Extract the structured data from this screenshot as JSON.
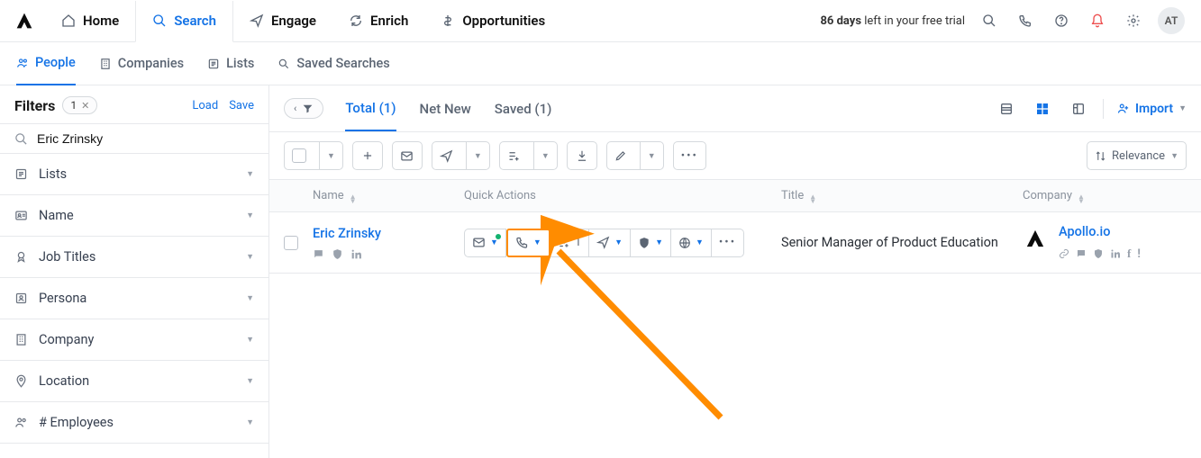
{
  "nav": {
    "items": [
      {
        "label": "Home"
      },
      {
        "label": "Search"
      },
      {
        "label": "Engage"
      },
      {
        "label": "Enrich"
      },
      {
        "label": "Opportunities"
      }
    ],
    "trial_days": "86 days",
    "trial_rest": " left in your free trial",
    "avatar": "AT"
  },
  "subnav": {
    "items": [
      {
        "label": "People"
      },
      {
        "label": "Companies"
      },
      {
        "label": "Lists"
      },
      {
        "label": "Saved Searches"
      }
    ]
  },
  "filters": {
    "title": "Filters",
    "chip_count": "1",
    "load": "Load",
    "save": "Save",
    "search_value": "Eric Zrinsky",
    "items": [
      {
        "label": "Lists"
      },
      {
        "label": "Name"
      },
      {
        "label": "Job Titles"
      },
      {
        "label": "Persona"
      },
      {
        "label": "Company"
      },
      {
        "label": "Location"
      },
      {
        "label": "# Employees"
      }
    ]
  },
  "content_tabs": {
    "items": [
      {
        "label": "Total (1)"
      },
      {
        "label": "Net New"
      },
      {
        "label": "Saved (1)"
      }
    ],
    "import": "Import"
  },
  "toolbar": {
    "relevance": "Relevance"
  },
  "columns": {
    "name": "Name",
    "quick_actions": "Quick Actions",
    "title": "Title",
    "company": "Company"
  },
  "row": {
    "name": "Eric Zrinsky",
    "seq_count": "1",
    "title": "Senior Manager of Product Education",
    "company": "Apollo.io"
  }
}
